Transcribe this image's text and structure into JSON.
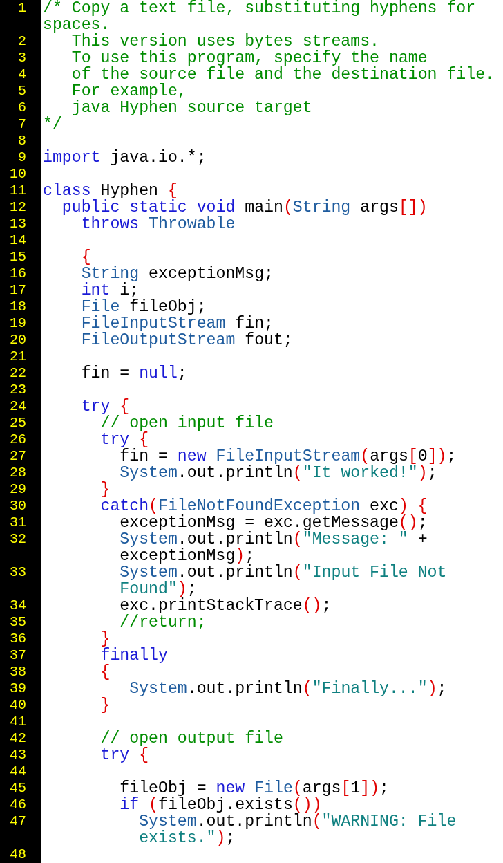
{
  "lines": [
    {
      "number": "1",
      "rows": [
        {
          "spans": [
            {
              "kind": "comment",
              "text": "/* Copy a text file, substituting hyphens for"
            }
          ]
        },
        {
          "spans": [
            {
              "kind": "comment",
              "text": "spaces."
            }
          ]
        }
      ]
    },
    {
      "number": "2",
      "rows": [
        {
          "spans": [
            {
              "kind": "comment",
              "text": "   This version uses bytes streams."
            }
          ]
        }
      ]
    },
    {
      "number": "3",
      "rows": [
        {
          "spans": [
            {
              "kind": "comment",
              "text": "   To use this program, specify the name"
            }
          ]
        }
      ]
    },
    {
      "number": "4",
      "rows": [
        {
          "spans": [
            {
              "kind": "comment",
              "text": "   of the source file and the destination file."
            }
          ]
        }
      ]
    },
    {
      "number": "5",
      "rows": [
        {
          "spans": [
            {
              "kind": "comment",
              "text": "   For example,"
            }
          ]
        }
      ]
    },
    {
      "number": "6",
      "rows": [
        {
          "spans": [
            {
              "kind": "comment",
              "text": "   java Hyphen source target"
            }
          ]
        }
      ]
    },
    {
      "number": "7",
      "rows": [
        {
          "spans": [
            {
              "kind": "comment",
              "text": "*/"
            }
          ]
        }
      ]
    },
    {
      "number": "8"
    },
    {
      "number": "9",
      "rows": [
        {
          "spans": [
            {
              "kind": "keyword",
              "text": "import"
            },
            {
              "kind": "plain",
              "text": " java.io.*;"
            }
          ]
        }
      ]
    },
    {
      "number": "10"
    },
    {
      "number": "11",
      "rows": [
        {
          "spans": [
            {
              "kind": "keyword",
              "text": "class"
            },
            {
              "kind": "plain",
              "text": " Hyphen "
            },
            {
              "kind": "punct",
              "text": "{"
            }
          ]
        }
      ]
    },
    {
      "number": "12",
      "rows": [
        {
          "spans": [
            {
              "kind": "keyword",
              "text": "  public static void"
            },
            {
              "kind": "plain",
              "text": " main"
            },
            {
              "kind": "punct",
              "text": "("
            },
            {
              "kind": "type",
              "text": "String"
            },
            {
              "kind": "plain",
              "text": " args"
            },
            {
              "kind": "punct",
              "text": "[])"
            }
          ]
        }
      ]
    },
    {
      "number": "13",
      "rows": [
        {
          "spans": [
            {
              "kind": "keyword",
              "text": "    throws "
            },
            {
              "kind": "type",
              "text": "Throwable"
            }
          ]
        }
      ]
    },
    {
      "number": "14"
    },
    {
      "number": "15",
      "rows": [
        {
          "spans": [
            {
              "kind": "punct",
              "text": "    {"
            }
          ]
        }
      ]
    },
    {
      "number": "16",
      "rows": [
        {
          "spans": [
            {
              "kind": "type",
              "text": "    String"
            },
            {
              "kind": "plain",
              "text": " exceptionMsg;"
            }
          ]
        }
      ]
    },
    {
      "number": "17",
      "rows": [
        {
          "spans": [
            {
              "kind": "keyword",
              "text": "    int"
            },
            {
              "kind": "plain",
              "text": " i;"
            }
          ]
        }
      ]
    },
    {
      "number": "18",
      "rows": [
        {
          "spans": [
            {
              "kind": "type",
              "text": "    File"
            },
            {
              "kind": "plain",
              "text": " fileObj;"
            }
          ]
        }
      ]
    },
    {
      "number": "19",
      "rows": [
        {
          "spans": [
            {
              "kind": "type",
              "text": "    FileInputStream"
            },
            {
              "kind": "plain",
              "text": " fin;"
            }
          ]
        }
      ]
    },
    {
      "number": "20",
      "rows": [
        {
          "spans": [
            {
              "kind": "type",
              "text": "    FileOutputStream"
            },
            {
              "kind": "plain",
              "text": " fout;"
            }
          ]
        }
      ]
    },
    {
      "number": "21"
    },
    {
      "number": "22",
      "rows": [
        {
          "spans": [
            {
              "kind": "plain",
              "text": "    fin = "
            },
            {
              "kind": "keyword",
              "text": "null"
            },
            {
              "kind": "plain",
              "text": ";"
            }
          ]
        }
      ]
    },
    {
      "number": "23"
    },
    {
      "number": "24",
      "rows": [
        {
          "spans": [
            {
              "kind": "keyword",
              "text": "    try "
            },
            {
              "kind": "punct",
              "text": "{"
            }
          ]
        }
      ]
    },
    {
      "number": "25",
      "rows": [
        {
          "spans": [
            {
              "kind": "comment",
              "text": "      // open input file"
            }
          ]
        }
      ]
    },
    {
      "number": "26",
      "rows": [
        {
          "spans": [
            {
              "kind": "keyword",
              "text": "      try "
            },
            {
              "kind": "punct",
              "text": "{"
            }
          ]
        }
      ]
    },
    {
      "number": "27",
      "rows": [
        {
          "spans": [
            {
              "kind": "plain",
              "text": "        fin = "
            },
            {
              "kind": "keyword",
              "text": "new "
            },
            {
              "kind": "type",
              "text": "FileInputStream"
            },
            {
              "kind": "punct",
              "text": "("
            },
            {
              "kind": "plain",
              "text": "args"
            },
            {
              "kind": "punct",
              "text": "["
            },
            {
              "kind": "plain",
              "text": "0"
            },
            {
              "kind": "punct",
              "text": "])"
            },
            {
              "kind": "plain",
              "text": ";"
            }
          ]
        }
      ]
    },
    {
      "number": "28",
      "rows": [
        {
          "spans": [
            {
              "kind": "type",
              "text": "        System"
            },
            {
              "kind": "plain",
              "text": ".out.println"
            },
            {
              "kind": "punct",
              "text": "("
            },
            {
              "kind": "string",
              "text": "\"It worked!\""
            },
            {
              "kind": "punct",
              "text": ")"
            },
            {
              "kind": "plain",
              "text": ";"
            }
          ]
        }
      ]
    },
    {
      "number": "29",
      "rows": [
        {
          "spans": [
            {
              "kind": "punct",
              "text": "      }"
            }
          ]
        }
      ]
    },
    {
      "number": "30",
      "rows": [
        {
          "spans": [
            {
              "kind": "keyword",
              "text": "      catch"
            },
            {
              "kind": "punct",
              "text": "("
            },
            {
              "kind": "type",
              "text": "FileNotFoundException"
            },
            {
              "kind": "plain",
              "text": " exc"
            },
            {
              "kind": "punct",
              "text": ") {"
            }
          ]
        }
      ]
    },
    {
      "number": "31",
      "rows": [
        {
          "spans": [
            {
              "kind": "plain",
              "text": "        exceptionMsg = exc.getMessage"
            },
            {
              "kind": "punct",
              "text": "()"
            },
            {
              "kind": "plain",
              "text": ";"
            }
          ]
        }
      ]
    },
    {
      "number": "32",
      "rows": [
        {
          "spans": [
            {
              "kind": "type",
              "text": "        System"
            },
            {
              "kind": "plain",
              "text": ".out.println"
            },
            {
              "kind": "punct",
              "text": "("
            },
            {
              "kind": "string",
              "text": "\"Message: \""
            },
            {
              "kind": "plain",
              "text": " +"
            }
          ]
        },
        {
          "spans": [
            {
              "kind": "plain",
              "text": "        exceptionMsg"
            },
            {
              "kind": "punct",
              "text": ")"
            },
            {
              "kind": "plain",
              "text": ";"
            }
          ]
        }
      ]
    },
    {
      "number": "33",
      "rows": [
        {
          "spans": [
            {
              "kind": "type",
              "text": "        System"
            },
            {
              "kind": "plain",
              "text": ".out.println"
            },
            {
              "kind": "punct",
              "text": "("
            },
            {
              "kind": "string",
              "text": "\"Input File Not"
            }
          ]
        },
        {
          "spans": [
            {
              "kind": "string",
              "text": "        Found\""
            },
            {
              "kind": "punct",
              "text": ")"
            },
            {
              "kind": "plain",
              "text": ";"
            }
          ]
        }
      ]
    },
    {
      "number": "34",
      "rows": [
        {
          "spans": [
            {
              "kind": "plain",
              "text": "        exc.printStackTrace"
            },
            {
              "kind": "punct",
              "text": "()"
            },
            {
              "kind": "plain",
              "text": ";"
            }
          ]
        }
      ]
    },
    {
      "number": "35",
      "rows": [
        {
          "spans": [
            {
              "kind": "comment",
              "text": "        //return;"
            }
          ]
        }
      ]
    },
    {
      "number": "36",
      "rows": [
        {
          "spans": [
            {
              "kind": "punct",
              "text": "      }"
            }
          ]
        }
      ]
    },
    {
      "number": "37",
      "rows": [
        {
          "spans": [
            {
              "kind": "keyword",
              "text": "      finally"
            }
          ]
        }
      ]
    },
    {
      "number": "38",
      "rows": [
        {
          "spans": [
            {
              "kind": "punct",
              "text": "      {"
            }
          ]
        }
      ]
    },
    {
      "number": "39",
      "rows": [
        {
          "spans": [
            {
              "kind": "type",
              "text": "         System"
            },
            {
              "kind": "plain",
              "text": ".out.println"
            },
            {
              "kind": "punct",
              "text": "("
            },
            {
              "kind": "string",
              "text": "\"Finally...\""
            },
            {
              "kind": "punct",
              "text": ")"
            },
            {
              "kind": "plain",
              "text": ";"
            }
          ]
        }
      ]
    },
    {
      "number": "40",
      "rows": [
        {
          "spans": [
            {
              "kind": "punct",
              "text": "      }"
            }
          ]
        }
      ]
    },
    {
      "number": "41"
    },
    {
      "number": "42",
      "rows": [
        {
          "spans": [
            {
              "kind": "comment",
              "text": "      // open output file"
            }
          ]
        }
      ]
    },
    {
      "number": "43",
      "rows": [
        {
          "spans": [
            {
              "kind": "keyword",
              "text": "      try "
            },
            {
              "kind": "punct",
              "text": "{"
            }
          ]
        }
      ]
    },
    {
      "number": "44"
    },
    {
      "number": "45",
      "rows": [
        {
          "spans": [
            {
              "kind": "plain",
              "text": "        fileObj = "
            },
            {
              "kind": "keyword",
              "text": "new "
            },
            {
              "kind": "type",
              "text": "File"
            },
            {
              "kind": "punct",
              "text": "("
            },
            {
              "kind": "plain",
              "text": "args"
            },
            {
              "kind": "punct",
              "text": "["
            },
            {
              "kind": "plain",
              "text": "1"
            },
            {
              "kind": "punct",
              "text": "])"
            },
            {
              "kind": "plain",
              "text": ";"
            }
          ]
        }
      ]
    },
    {
      "number": "46",
      "rows": [
        {
          "spans": [
            {
              "kind": "keyword",
              "text": "        if "
            },
            {
              "kind": "punct",
              "text": "("
            },
            {
              "kind": "plain",
              "text": "fileObj.exists"
            },
            {
              "kind": "punct",
              "text": "())"
            }
          ]
        }
      ]
    },
    {
      "number": "47",
      "rows": [
        {
          "spans": [
            {
              "kind": "type",
              "text": "          System"
            },
            {
              "kind": "plain",
              "text": ".out.println"
            },
            {
              "kind": "punct",
              "text": "("
            },
            {
              "kind": "string",
              "text": "\"WARNING: File"
            }
          ]
        },
        {
          "spans": [
            {
              "kind": "string",
              "text": "          exists.\""
            },
            {
              "kind": "punct",
              "text": ")"
            },
            {
              "kind": "plain",
              "text": ";"
            }
          ]
        }
      ]
    },
    {
      "number": "48"
    }
  ]
}
